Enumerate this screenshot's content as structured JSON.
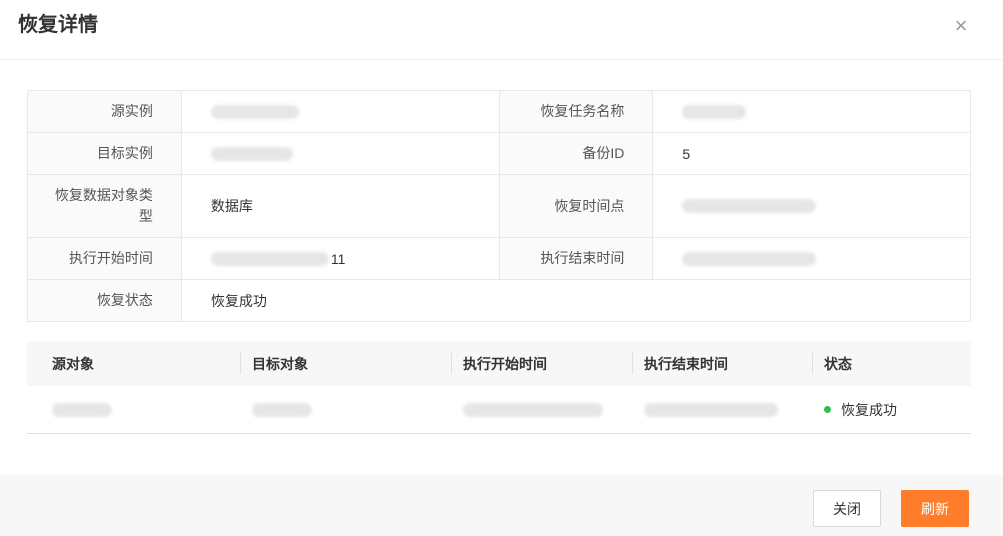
{
  "dialog": {
    "title": "恢复详情",
    "close_glyph": "×"
  },
  "info": {
    "source_instance_label": "源实例",
    "restore_task_name_label": "恢复任务名称",
    "target_instance_label": "目标实例",
    "backup_id_label": "备份ID",
    "backup_id_value": "5",
    "restore_object_type_label": "恢复数据对象类型",
    "restore_object_type_value": "数据库",
    "restore_time_point_label": "恢复时间点",
    "start_time_label": "执行开始时间",
    "start_time_partial": "11",
    "end_time_label": "执行结束时间",
    "restore_status_label": "恢复状态",
    "restore_status_value": "恢复成功"
  },
  "table": {
    "columns": [
      "源对象",
      "目标对象",
      "执行开始时间",
      "执行结束时间",
      "状态"
    ],
    "rows": [
      {
        "status": "恢复成功",
        "status_color": "#2fbf4a"
      }
    ]
  },
  "footer": {
    "close_label": "关闭",
    "refresh_label": "刷新",
    "accent": "#ff7d2a"
  }
}
